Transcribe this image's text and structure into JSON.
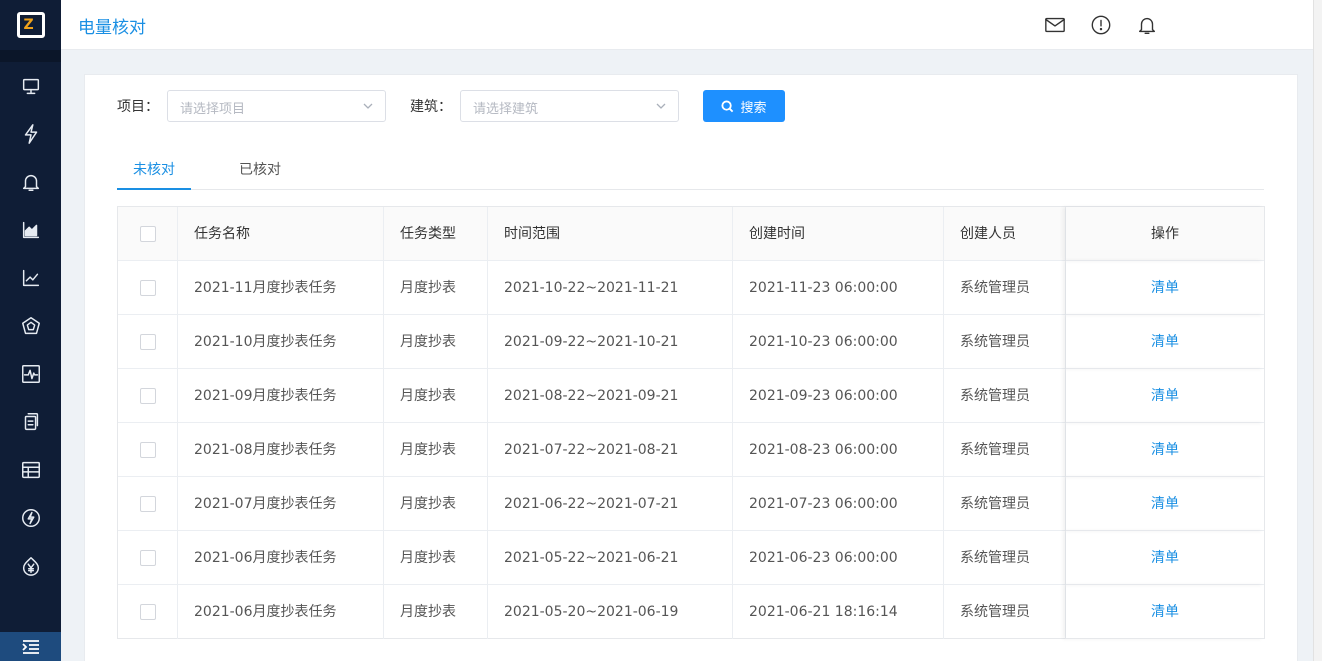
{
  "header": {
    "title": "电量核对"
  },
  "filters": {
    "project_label": "项目：",
    "project_placeholder": "请选择项目",
    "building_label": "建筑：",
    "building_placeholder": "请选择建筑",
    "search_label": "搜索"
  },
  "tabs": [
    {
      "label": "未核对",
      "active": true
    },
    {
      "label": "已核对",
      "active": false
    }
  ],
  "table": {
    "columns": [
      "任务名称",
      "任务类型",
      "时间范围",
      "创建时间",
      "创建人员",
      "操作"
    ],
    "rows": [
      {
        "name": "2021-11月度抄表任务",
        "type": "月度抄表",
        "range": "2021-10-22~2021-11-21",
        "created": "2021-11-23 06:00:00",
        "creator": "系统管理员",
        "action": "清单"
      },
      {
        "name": "2021-10月度抄表任务",
        "type": "月度抄表",
        "range": "2021-09-22~2021-10-21",
        "created": "2021-10-23 06:00:00",
        "creator": "系统管理员",
        "action": "清单"
      },
      {
        "name": "2021-09月度抄表任务",
        "type": "月度抄表",
        "range": "2021-08-22~2021-09-21",
        "created": "2021-09-23 06:00:00",
        "creator": "系统管理员",
        "action": "清单"
      },
      {
        "name": "2021-08月度抄表任务",
        "type": "月度抄表",
        "range": "2021-07-22~2021-08-21",
        "created": "2021-08-23 06:00:00",
        "creator": "系统管理员",
        "action": "清单"
      },
      {
        "name": "2021-07月度抄表任务",
        "type": "月度抄表",
        "range": "2021-06-22~2021-07-21",
        "created": "2021-07-23 06:00:00",
        "creator": "系统管理员",
        "action": "清单"
      },
      {
        "name": "2021-06月度抄表任务",
        "type": "月度抄表",
        "range": "2021-05-22~2021-06-21",
        "created": "2021-06-23 06:00:00",
        "creator": "系统管理员",
        "action": "清单"
      },
      {
        "name": "2021-06月度抄表任务",
        "type": "月度抄表",
        "range": "2021-05-20~2021-06-19",
        "created": "2021-06-21 18:16:14",
        "creator": "系统管理员",
        "action": "清单"
      }
    ]
  },
  "sidebar": {
    "icons": [
      "monitor-icon",
      "lightning-icon",
      "bell-icon",
      "area-chart-icon",
      "line-chart-icon",
      "pentagon-icon",
      "pulse-icon",
      "clipboard-icon",
      "table-icon",
      "lightning-circle-icon",
      "yen-icon"
    ]
  },
  "colors": {
    "accent": "#1a8fe3",
    "sidebar": "#0f1d36",
    "button": "#1e90ff"
  }
}
